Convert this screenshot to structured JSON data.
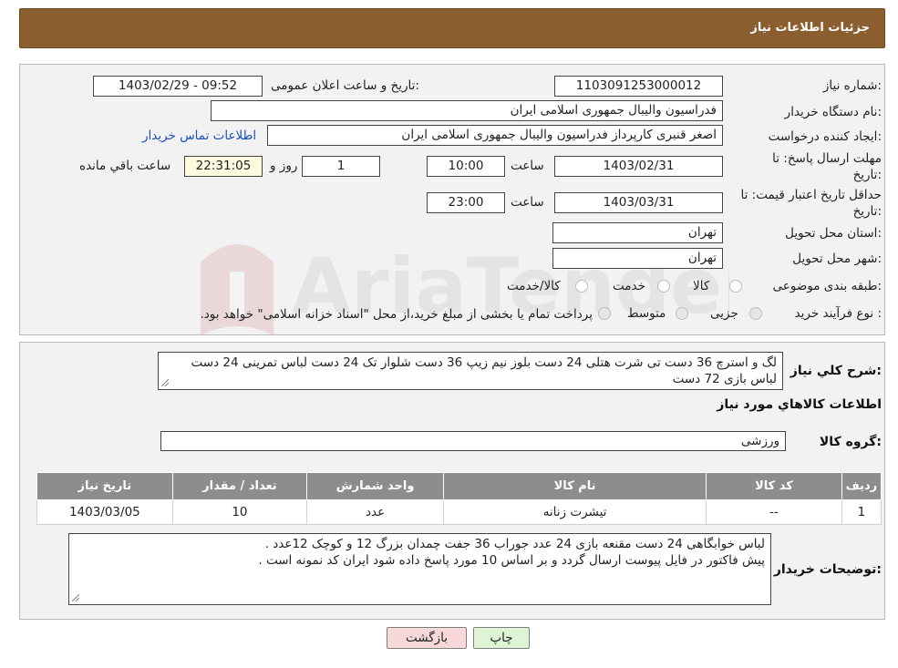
{
  "header": {
    "title": "جزئیات اطلاعات نیاز"
  },
  "details": {
    "need_number_label": "شماره نیاز:",
    "need_number": "1103091253000012",
    "announce_label": "تاریخ و ساعت اعلان عمومی:",
    "announce_value": "1403/02/29 - 09:52",
    "buyer_label": "نام دستگاه خریدار:",
    "buyer_value": "فدراسیون والیبال جمهوری اسلامی ایران",
    "creator_label": "ایجاد کننده درخواست:",
    "creator_value": "اصغر  قنبری  کارپرداز  فدراسیون والیبال جمهوری اسلامی ایران",
    "contact_link": "اطلاعات تماس خریدار",
    "deadline_label_1": "مهلت ارسال پاسخ: تا",
    "deadline_label_2": "تاریخ:",
    "deadline_date": "1403/02/31",
    "time_label": "ساعت",
    "deadline_time": "10:00",
    "days_value": "1",
    "days_label": "روز و",
    "remaining_time": "22:31:05",
    "remaining_label": "ساعت باقي مانده",
    "validity_label_1": "حداقل تاریخ اعتبار قیمت: تا",
    "validity_label_2": "تاریخ:",
    "validity_date": "1403/03/31",
    "validity_time": "23:00",
    "province_label": "استان محل تحویل:",
    "province_value": "تهران",
    "city_label": "شهر محل تحویل:",
    "city_value": "تهران",
    "category_label": "طبقه بندی موضوعی:",
    "category_options": [
      "کالا",
      "خدمت",
      "کالا/خدمت"
    ],
    "process_label": "نوع فرآیند خرید :",
    "process_options": [
      "جزیی",
      "متوسط"
    ],
    "process_note": "پرداخت تمام یا بخشی از مبلغ خرید،از محل \"اسناد خزانه اسلامی\" خواهد بود."
  },
  "summary": {
    "desc_label": "شرح کلي نياز:",
    "desc_value": "لگ و استرچ 36 دست تی شرت هتلی 24 دست بلوز نیم زیپ 36 دست شلوار تک 24 دست لباس تمرینی 24 دست لباس بازی 72 دست",
    "goods_info_title": "اطلاعات کالاهاي مورد نياز",
    "group_label": "گروه کالا:",
    "group_value": "ورزشی",
    "table": {
      "headers": [
        "رديف",
        "کد کالا",
        "نام کالا",
        "واحد شمارش",
        "تعداد / مقدار",
        "تاريخ نياز"
      ],
      "rows": [
        [
          "1",
          "--",
          "تیشرت زنانه",
          "عدد",
          "10",
          "1403/03/05"
        ]
      ]
    },
    "buyer_notes_label": "توضيحات خريدار:",
    "buyer_notes_line1": "لباس خوابگاهی 24 دست مقنعه بازی 24 عدد جوراب 36 جفت چمدان بزرگ 12 و کوچک 12عدد .",
    "buyer_notes_line2": "پیش فاکتور در فایل پیوست ارسال گردد و بر اساس 10 مورد پاسخ داده شود ایران کد نمونه است ."
  },
  "buttons": {
    "print": "چاپ",
    "back": "بازگشت"
  },
  "watermark": {
    "text": "AriaTender.neT"
  },
  "colors": {
    "header_bg": "#8b5e2f",
    "link": "#1a4fbf",
    "back_btn": "#f7d9d9",
    "print_btn": "#dff3d6"
  }
}
